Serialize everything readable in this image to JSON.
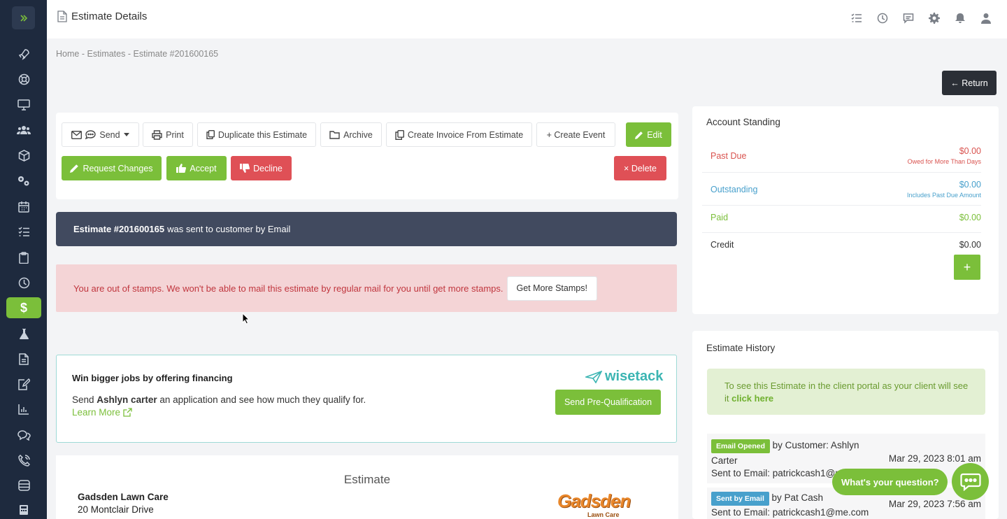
{
  "page": {
    "title": "Estimate Details"
  },
  "breadcrumb": {
    "home": "Home",
    "estimates": "Estimates",
    "current": "Estimate #201600165",
    "sep": "-"
  },
  "return_label": "← Return",
  "actions": {
    "send": "Send",
    "print": "Print",
    "duplicate": "Duplicate this Estimate",
    "archive": "Archive",
    "create_invoice": "Create Invoice From Estimate",
    "create_event": "+ Create Event",
    "edit": "Edit",
    "request_changes": "Request Changes",
    "accept": "Accept",
    "decline": "Decline",
    "delete": "× Delete"
  },
  "sent_banner": {
    "estimate": "Estimate #201600165",
    "text": "was sent to customer by Email"
  },
  "stamps": {
    "message": "You are out of stamps. We won't be able to mail this estimate by regular mail for you until get more stamps.",
    "button": "Get More Stamps!"
  },
  "financing": {
    "heading": "Win bigger jobs by offering financing",
    "line_prefix": "Send",
    "customer": "Ashlyn carter",
    "line_suffix": "an application and see how much they qualify for.",
    "learn_more": "Learn More",
    "logo_text": "wisetack",
    "button": "Send Pre-Qualification"
  },
  "estimate_doc": {
    "title": "Estimate",
    "company": "Gadsden Lawn Care",
    "address": "20 Montclair Drive",
    "logo_text": "Gadsden",
    "logo_sub": "Lawn Care"
  },
  "account": {
    "title": "Account Standing",
    "past_due": {
      "label": "Past Due",
      "amount": "$0.00",
      "sub": "Owed for More Than Days"
    },
    "outstanding": {
      "label": "Outstanding",
      "amount": "$0.00",
      "sub": "Includes Past Due Amount"
    },
    "paid": {
      "label": "Paid",
      "amount": "$0.00"
    },
    "credit": {
      "label": "Credit",
      "amount": "$0.00"
    },
    "add": "+"
  },
  "history": {
    "title": "Estimate History",
    "portal_note": "To see this Estimate in the client portal as your client will see it",
    "portal_link": "click here",
    "items": [
      {
        "tag": "Email Opened",
        "by": "by Customer: Ashlyn",
        "by2": "Carter",
        "date": "Mar 29, 2023 8:01 am",
        "to": "Sent to Email: patrickcash1@m"
      },
      {
        "tag": "Sent by Email",
        "by": "by Pat Cash",
        "date": "Mar 29, 2023 7:56 am",
        "to": "Sent to Email: patrickcash1@me.com"
      }
    ]
  },
  "chat": {
    "prompt": "What's your question?"
  },
  "colors": {
    "green": "#7bbf3a",
    "red": "#df5056",
    "sidebar": "#1e2a3e",
    "banner_dark": "#414a5f",
    "pink": "#f4d4d6",
    "teal": "#3cb5b3",
    "blue": "#48a0cc"
  }
}
